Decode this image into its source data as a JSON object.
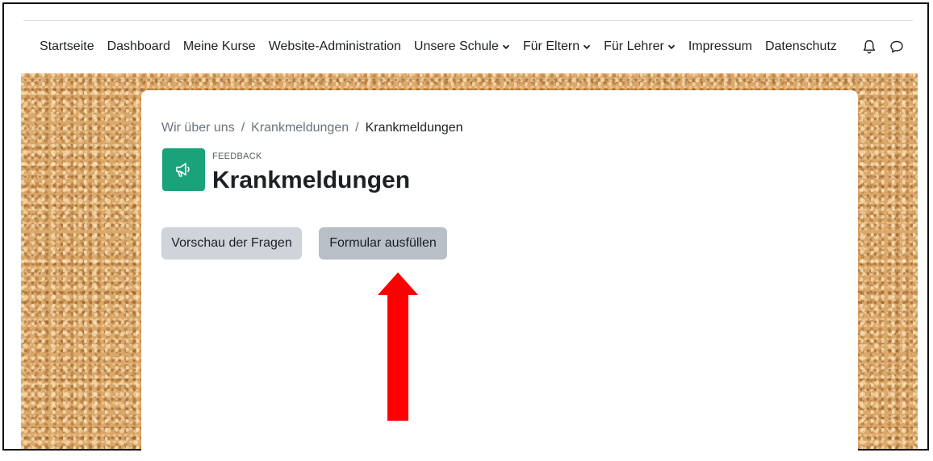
{
  "navbar": {
    "items": [
      {
        "label": "Startseite",
        "dropdown": false
      },
      {
        "label": "Dashboard",
        "dropdown": false
      },
      {
        "label": "Meine Kurse",
        "dropdown": false
      },
      {
        "label": "Website-Administration",
        "dropdown": false
      },
      {
        "label": "Unsere Schule",
        "dropdown": true
      },
      {
        "label": "Für Eltern",
        "dropdown": true
      },
      {
        "label": "Für Lehrer",
        "dropdown": true
      },
      {
        "label": "Impressum",
        "dropdown": false
      },
      {
        "label": "Datenschutz",
        "dropdown": false
      }
    ],
    "icons": [
      "bell-icon",
      "chat-bubble-icon"
    ]
  },
  "breadcrumb": {
    "items": [
      "Wir über uns",
      "Krankmeldungen"
    ],
    "separator": "/",
    "current": "Krankmeldungen"
  },
  "activity": {
    "type_label": "FEEDBACK",
    "title": "Krankmeldungen",
    "icon": "megaphone-icon",
    "icon_color": "#1aa37a"
  },
  "buttons": {
    "preview": "Vorschau der Fragen",
    "fill": "Formular ausfüllen"
  },
  "annotation": {
    "arrow_color": "#ff0000"
  }
}
